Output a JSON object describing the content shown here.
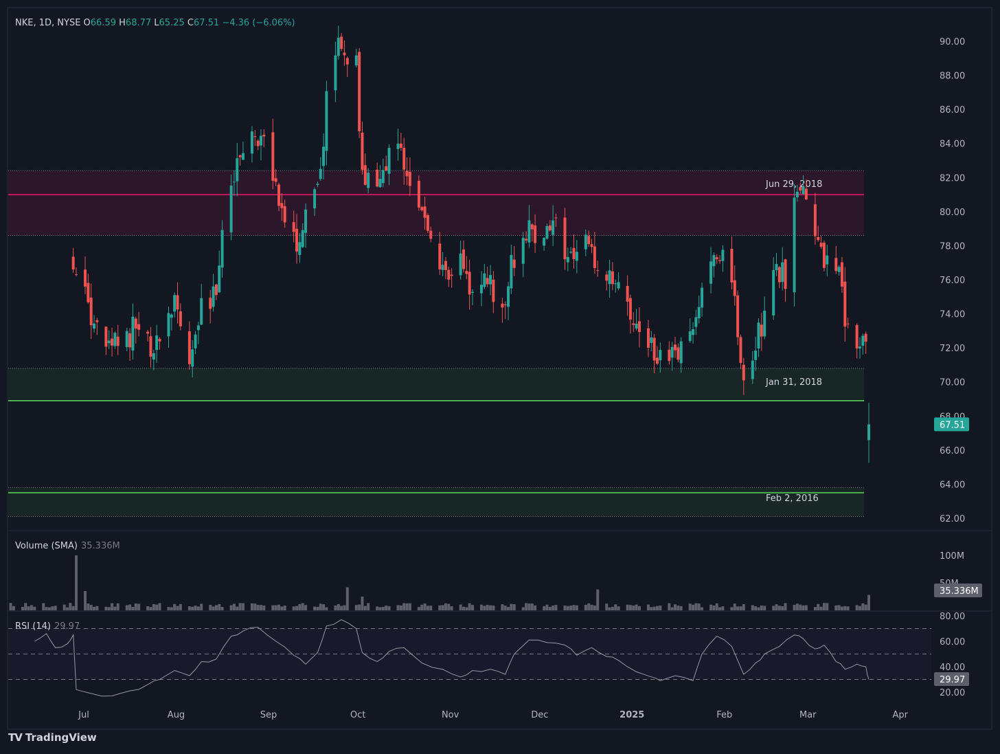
{
  "header": {
    "symbol": "NKE, 1D, NYSE",
    "o_label": "O",
    "o": "66.59",
    "h_label": "H",
    "h": "68.77",
    "l_label": "L",
    "l": "65.25",
    "c_label": "C",
    "c": "67.51",
    "change": "−4.36 (−6.06%)"
  },
  "colors": {
    "background": "#131722",
    "up": "#26a69a",
    "down": "#ef5350",
    "resistance": "#c2185b",
    "support": "#4caf50",
    "text": "#d1d4dc",
    "axis_text": "#b2b5be",
    "volume": "#5d606b"
  },
  "chart_data": [
    {
      "type": "candlestick",
      "title": "NKE, 1D, NYSE",
      "ylim": [
        61.5,
        91.0
      ],
      "y_ticks": [
        "90.00",
        "88.00",
        "86.00",
        "84.00",
        "82.00",
        "80.00",
        "78.00",
        "76.00",
        "74.00",
        "72.00",
        "70.00",
        "68.00",
        "66.00",
        "64.00",
        "62.00"
      ],
      "x_ticks": [
        "Jul",
        "Aug",
        "Sep",
        "Oct",
        "Nov",
        "Dec",
        "2025",
        "Feb",
        "Mar",
        "Apr"
      ],
      "last_price_label": "67.51",
      "last_candle": {
        "o": 66.59,
        "h": 68.77,
        "l": 65.25,
        "c": 67.51
      },
      "close_path": [
        {
          "x": "2024-06-27",
          "y": 77.0
        },
        {
          "x": "2024-07-01",
          "y": 75.0
        },
        {
          "x": "2024-07-05",
          "y": 72.8
        },
        {
          "x": "2024-07-09",
          "y": 71.9
        },
        {
          "x": "2024-07-15",
          "y": 72.5
        },
        {
          "x": "2024-07-19",
          "y": 73.7
        },
        {
          "x": "2024-07-24",
          "y": 71.7
        },
        {
          "x": "2024-07-29",
          "y": 73.8
        },
        {
          "x": "2024-08-01",
          "y": 74.6
        },
        {
          "x": "2024-08-05",
          "y": 71.2
        },
        {
          "x": "2024-08-09",
          "y": 74.2
        },
        {
          "x": "2024-08-14",
          "y": 75.0
        },
        {
          "x": "2024-08-16",
          "y": 78.8
        },
        {
          "x": "2024-08-20",
          "y": 82.5
        },
        {
          "x": "2024-08-26",
          "y": 84.0
        },
        {
          "x": "2024-08-29",
          "y": 84.8
        },
        {
          "x": "2024-09-03",
          "y": 81.5
        },
        {
          "x": "2024-09-06",
          "y": 79.7
        },
        {
          "x": "2024-09-11",
          "y": 77.6
        },
        {
          "x": "2024-09-13",
          "y": 79.6
        },
        {
          "x": "2024-09-18",
          "y": 82.0
        },
        {
          "x": "2024-09-20",
          "y": 86.5
        },
        {
          "x": "2024-09-24",
          "y": 89.8
        },
        {
          "x": "2024-09-26",
          "y": 89.3
        },
        {
          "x": "2024-09-30",
          "y": 88.4
        },
        {
          "x": "2024-10-02",
          "y": 82.3
        },
        {
          "x": "2024-10-07",
          "y": 80.8
        },
        {
          "x": "2024-10-10",
          "y": 82.8
        },
        {
          "x": "2024-10-14",
          "y": 84.5
        },
        {
          "x": "2024-10-17",
          "y": 82.5
        },
        {
          "x": "2024-10-21",
          "y": 80.0
        },
        {
          "x": "2024-10-25",
          "y": 78.6
        },
        {
          "x": "2024-10-30",
          "y": 76.5
        },
        {
          "x": "2024-11-05",
          "y": 76.8
        },
        {
          "x": "2024-11-08",
          "y": 75.2
        },
        {
          "x": "2024-11-13",
          "y": 76.3
        },
        {
          "x": "2024-11-18",
          "y": 73.8
        },
        {
          "x": "2024-11-21",
          "y": 77.0
        },
        {
          "x": "2024-11-26",
          "y": 78.9
        },
        {
          "x": "2024-12-02",
          "y": 78.6
        },
        {
          "x": "2024-12-06",
          "y": 79.0
        },
        {
          "x": "2024-12-11",
          "y": 77.0
        },
        {
          "x": "2024-12-16",
          "y": 78.2
        },
        {
          "x": "2024-12-20",
          "y": 76.5
        },
        {
          "x": "2024-12-27",
          "y": 75.2
        },
        {
          "x": "2025-01-02",
          "y": 73.5
        },
        {
          "x": "2025-01-07",
          "y": 72.0
        },
        {
          "x": "2025-01-13",
          "y": 71.3
        },
        {
          "x": "2025-01-17",
          "y": 71.6
        },
        {
          "x": "2025-01-22",
          "y": 73.8
        },
        {
          "x": "2025-01-27",
          "y": 77.2
        },
        {
          "x": "2025-01-30",
          "y": 77.8
        },
        {
          "x": "2025-02-04",
          "y": 74.5
        },
        {
          "x": "2025-02-07",
          "y": 69.7
        },
        {
          "x": "2025-02-11",
          "y": 72.3
        },
        {
          "x": "2025-02-13",
          "y": 73.2
        },
        {
          "x": "2025-02-18",
          "y": 76.8
        },
        {
          "x": "2025-02-21",
          "y": 76.0
        },
        {
          "x": "2025-02-24",
          "y": 80.5
        },
        {
          "x": "2025-02-26",
          "y": 81.5
        },
        {
          "x": "2025-03-03",
          "y": 78.2
        },
        {
          "x": "2025-03-07",
          "y": 77.0
        },
        {
          "x": "2025-03-11",
          "y": 76.0
        },
        {
          "x": "2025-03-13",
          "y": 74.0
        },
        {
          "x": "2025-03-17",
          "y": 72.3
        },
        {
          "x": "2025-03-19",
          "y": 73.0
        },
        {
          "x": "2025-03-20",
          "y": 71.8
        }
      ],
      "zones": [
        {
          "label": "Jun 29, 2018",
          "line": 81.0,
          "top": 82.4,
          "bottom": 78.6,
          "kind": "resistance"
        },
        {
          "label": "Jan 31, 2018",
          "line": 68.9,
          "top": 70.8,
          "bottom": 68.9,
          "kind": "support"
        },
        {
          "label": "Feb 2, 2016",
          "line": 63.5,
          "top": 63.8,
          "bottom": 62.1,
          "kind": "support"
        }
      ]
    },
    {
      "type": "bar",
      "title": "Volume (SMA)",
      "current_value_label": "35.336M",
      "y_ticks": [
        "100M",
        "50M"
      ],
      "ylim": [
        0,
        110
      ],
      "unit": "M",
      "typical_value": 9,
      "spikes": [
        {
          "x": "2024-06-28",
          "y": 100
        },
        {
          "x": "2024-07-01",
          "y": 35
        },
        {
          "x": "2024-09-27",
          "y": 42
        },
        {
          "x": "2024-10-02",
          "y": 25
        },
        {
          "x": "2024-12-20",
          "y": 38
        },
        {
          "x": "2025-03-21",
          "y": 28
        }
      ]
    },
    {
      "type": "line",
      "title": "RSI (14)",
      "current_value_label": "29.97",
      "ylim": [
        13,
        82
      ],
      "y_ticks": [
        "80.00",
        "60.00",
        "40.00",
        "20.00"
      ],
      "levels": [
        70,
        50,
        30
      ],
      "points": [
        {
          "x": "2024-06-14",
          "y": 60
        },
        {
          "x": "2024-06-18",
          "y": 66
        },
        {
          "x": "2024-06-21",
          "y": 55
        },
        {
          "x": "2024-06-25",
          "y": 58
        },
        {
          "x": "2024-06-27",
          "y": 65
        },
        {
          "x": "2024-06-28",
          "y": 22
        },
        {
          "x": "2024-07-03",
          "y": 19
        },
        {
          "x": "2024-07-10",
          "y": 17
        },
        {
          "x": "2024-07-16",
          "y": 21
        },
        {
          "x": "2024-07-22",
          "y": 26
        },
        {
          "x": "2024-07-26",
          "y": 30
        },
        {
          "x": "2024-07-31",
          "y": 37
        },
        {
          "x": "2024-08-05",
          "y": 33
        },
        {
          "x": "2024-08-09",
          "y": 44
        },
        {
          "x": "2024-08-14",
          "y": 46
        },
        {
          "x": "2024-08-19",
          "y": 64
        },
        {
          "x": "2024-08-23",
          "y": 68
        },
        {
          "x": "2024-08-28",
          "y": 71
        },
        {
          "x": "2024-09-03",
          "y": 60
        },
        {
          "x": "2024-09-09",
          "y": 49
        },
        {
          "x": "2024-09-13",
          "y": 42
        },
        {
          "x": "2024-09-17",
          "y": 51
        },
        {
          "x": "2024-09-20",
          "y": 72
        },
        {
          "x": "2024-09-25",
          "y": 77
        },
        {
          "x": "2024-09-30",
          "y": 70
        },
        {
          "x": "2024-10-02",
          "y": 51
        },
        {
          "x": "2024-10-07",
          "y": 44
        },
        {
          "x": "2024-10-11",
          "y": 52
        },
        {
          "x": "2024-10-16",
          "y": 55
        },
        {
          "x": "2024-10-22",
          "y": 43
        },
        {
          "x": "2024-10-29",
          "y": 38
        },
        {
          "x": "2024-11-04",
          "y": 32
        },
        {
          "x": "2024-11-08",
          "y": 37
        },
        {
          "x": "2024-11-14",
          "y": 38
        },
        {
          "x": "2024-11-19",
          "y": 34
        },
        {
          "x": "2024-11-22",
          "y": 50
        },
        {
          "x": "2024-11-27",
          "y": 61
        },
        {
          "x": "2024-12-03",
          "y": 59
        },
        {
          "x": "2024-12-09",
          "y": 57
        },
        {
          "x": "2024-12-13",
          "y": 49
        },
        {
          "x": "2024-12-18",
          "y": 55
        },
        {
          "x": "2024-12-23",
          "y": 48
        },
        {
          "x": "2024-12-27",
          "y": 45
        },
        {
          "x": "2025-01-02",
          "y": 36
        },
        {
          "x": "2025-01-07",
          "y": 32
        },
        {
          "x": "2025-01-10",
          "y": 29
        },
        {
          "x": "2025-01-15",
          "y": 33
        },
        {
          "x": "2025-01-21",
          "y": 29
        },
        {
          "x": "2025-01-24",
          "y": 50
        },
        {
          "x": "2025-01-29",
          "y": 64
        },
        {
          "x": "2025-02-03",
          "y": 56
        },
        {
          "x": "2025-02-07",
          "y": 34
        },
        {
          "x": "2025-02-11",
          "y": 43
        },
        {
          "x": "2025-02-14",
          "y": 50
        },
        {
          "x": "2025-02-19",
          "y": 56
        },
        {
          "x": "2025-02-24",
          "y": 65
        },
        {
          "x": "2025-02-27",
          "y": 62
        },
        {
          "x": "2025-03-03",
          "y": 54
        },
        {
          "x": "2025-03-06",
          "y": 57
        },
        {
          "x": "2025-03-10",
          "y": 44
        },
        {
          "x": "2025-03-13",
          "y": 38
        },
        {
          "x": "2025-03-17",
          "y": 42
        },
        {
          "x": "2025-03-20",
          "y": 40
        },
        {
          "x": "2025-03-21",
          "y": 30
        }
      ]
    }
  ],
  "brand": {
    "name": "TradingView",
    "logo": "TV"
  }
}
